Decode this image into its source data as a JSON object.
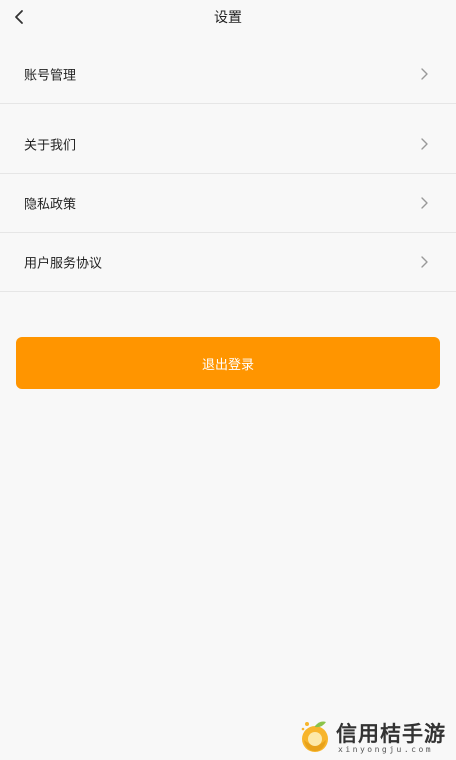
{
  "header": {
    "title": "设置",
    "back_icon": "chevron-left-icon"
  },
  "menu": {
    "items": [
      {
        "label": "账号管理",
        "icon": "chevron-right-icon"
      },
      {
        "label": "关于我们",
        "icon": "chevron-right-icon"
      },
      {
        "label": "隐私政策",
        "icon": "chevron-right-icon"
      },
      {
        "label": "用户服务协议",
        "icon": "chevron-right-icon"
      }
    ]
  },
  "logout": {
    "label": "退出登录",
    "color": "#ff9500"
  },
  "watermark": {
    "brand": "信用桔手游",
    "domain": "xinyongju.com"
  },
  "colors": {
    "background": "#f8f8f8",
    "accent": "#ff9500",
    "divider": "#e6e6e6"
  }
}
